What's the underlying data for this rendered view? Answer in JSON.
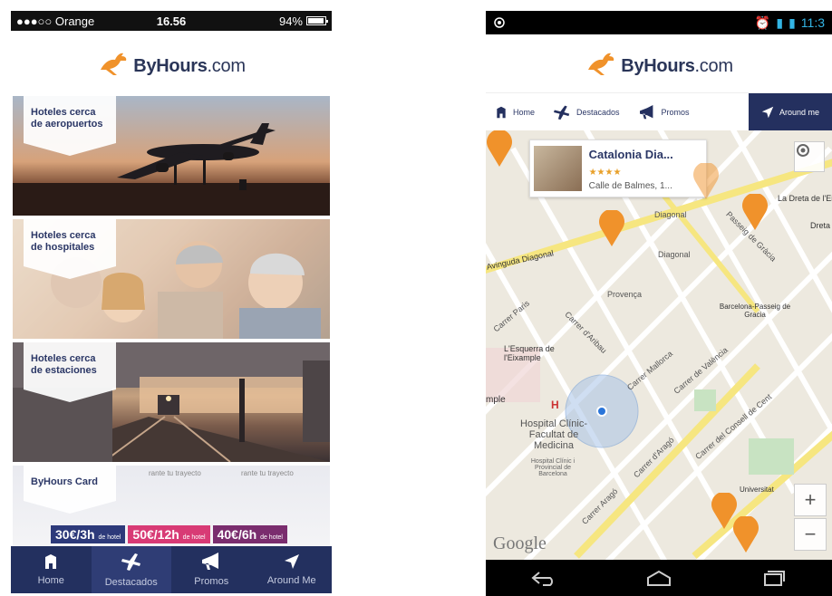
{
  "left_phone": {
    "status": {
      "carrier": "●●●○○ Orange",
      "time": "16.56",
      "battery": "94%"
    },
    "logo": {
      "brand": "ByHours",
      "domain": ".com"
    },
    "tiles": [
      {
        "label": "Hoteles cerca de aeropuertos"
      },
      {
        "label": "Hoteles cerca de hospitales"
      },
      {
        "label": "Hoteles cerca de estaciones"
      },
      {
        "label": "ByHours Card"
      }
    ],
    "card_banner": "rante tu trayecto",
    "prices": [
      {
        "big": "30€/3h",
        "small": "de hotel"
      },
      {
        "big": "50€/12h",
        "small": "de hotel"
      },
      {
        "big": "40€/6h",
        "small": "de hotel"
      }
    ],
    "tabbar": [
      {
        "label": "Home",
        "icon": "home-icon"
      },
      {
        "label": "Destacados",
        "icon": "plane-icon"
      },
      {
        "label": "Promos",
        "icon": "megaphone-icon"
      },
      {
        "label": "Around Me",
        "icon": "location-arrow-icon"
      }
    ]
  },
  "right_phone": {
    "status": {
      "time": "11:3"
    },
    "logo": {
      "brand": "ByHours",
      "domain": ".com"
    },
    "nav": [
      {
        "label": "Home"
      },
      {
        "label": "Destacados"
      },
      {
        "label": "Promos"
      },
      {
        "label": "Around me"
      }
    ],
    "hotel_card": {
      "name": "Catalonia Dia...",
      "stars": "★★★★",
      "address": "Calle de Balmes, 1..."
    },
    "map_labels": {
      "av_diagonal": "Avinguda Diagonal",
      "diagonal1": "Diagonal",
      "diagonal2": "Diagonal",
      "passeig": "Passeig de Gràcia",
      "dreta": "La Dreta de l'Eixample",
      "dreta2": "Dreta l'Eixa",
      "provenca": "Provença",
      "esquerra": "L'Esquerra de l'Eixample",
      "carrer_paris": "Carrer Paris",
      "carrer_aribau": "Carrer d'Aribau",
      "carrer_mallorca": "Carrer Mallorca",
      "carrer_valencia": "Carrer de València",
      "carrer_consell": "Carrer del Consell de Cent",
      "carrer_arago": "Carrer d'Aragó",
      "carrer_arago2": "Carrer Aragó",
      "hospital": "Hospital Clínic-Facultat de Medicina",
      "hospital2": "Hospital Clínic i Provincial de Barcelona",
      "passeig_gracia_station": "Barcelona-Passeig de Gracia",
      "universitat": "Universitat",
      "mple": "mple",
      "h": "H",
      "google": "Google"
    },
    "controls": {
      "zoom_in": "+",
      "zoom_out": "−"
    }
  },
  "colors": {
    "navy": "#23305f",
    "orange": "#f0922b",
    "pink": "#d83b75",
    "map_yellow": "#f6e680"
  }
}
